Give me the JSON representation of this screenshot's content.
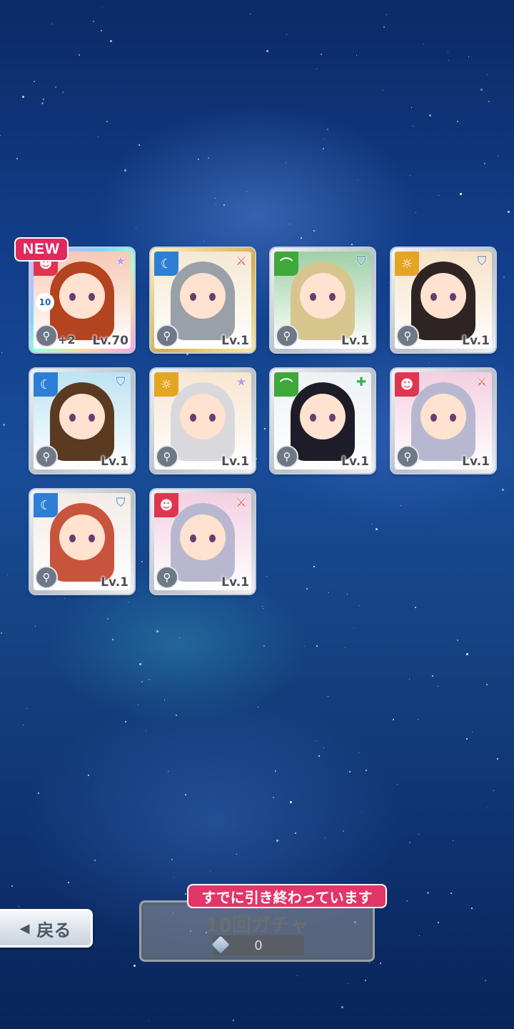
{
  "new_label": "NEW",
  "cards": [
    {
      "attr": "☻",
      "attr_color": "#e0354f",
      "role": "★",
      "role_color": "#b9a0e0",
      "level": "Lv.70",
      "plus": "+2",
      "rank": "10",
      "frame": "rainbow",
      "bg": "#f7c9b4",
      "hair": "#b3441f"
    },
    {
      "attr": "☾",
      "attr_color": "#2d7fd6",
      "role": "⚔",
      "role_color": "#e25b5b",
      "level": "Lv.1",
      "frame": "gold",
      "bg": "#f5e8d3",
      "hair": "#9aa0a8"
    },
    {
      "attr": "⌒",
      "attr_color": "#3ea83a",
      "role": "⛉",
      "role_color": "#3a79d0",
      "level": "Lv.1",
      "frame": "silver",
      "bg": "#9ed0a6",
      "hair": "#d8c58e"
    },
    {
      "attr": "☼",
      "attr_color": "#e5a524",
      "role": "⛉",
      "role_color": "#3a79d0",
      "level": "Lv.1",
      "frame": "silver",
      "bg": "#f7e2c6",
      "hair": "#2e2424"
    },
    {
      "attr": "☾",
      "attr_color": "#2d7fd6",
      "role": "⛉",
      "role_color": "#3a79d0",
      "level": "Lv.1",
      "frame": "silver",
      "bg": "#bde3f2",
      "hair": "#5b3a22"
    },
    {
      "attr": "☼",
      "attr_color": "#e5a524",
      "role": "★",
      "role_color": "#b9a0e0",
      "level": "Lv.1",
      "frame": "silver",
      "bg": "#f8e6d0",
      "hair": "#d9d9dd"
    },
    {
      "attr": "⌒",
      "attr_color": "#3ea83a",
      "role": "✚",
      "role_color": "#3fae53",
      "level": "Lv.1",
      "frame": "silver",
      "bg": "#eef2f5",
      "hair": "#1f1c2a"
    },
    {
      "attr": "☻",
      "attr_color": "#e0354f",
      "role": "⚔",
      "role_color": "#e25b5b",
      "level": "Lv.1",
      "frame": "silver",
      "bg": "#f4cfe2",
      "hair": "#b7b8cf"
    },
    {
      "attr": "☾",
      "attr_color": "#2d7fd6",
      "role": "⛉",
      "role_color": "#3a79d0",
      "level": "Lv.1",
      "frame": "silver",
      "bg": "#f4ebe6",
      "hair": "#c9543e"
    },
    {
      "attr": "☻",
      "attr_color": "#e0354f",
      "role": "⚔",
      "role_color": "#e25b5b",
      "level": "Lv.1",
      "frame": "silver",
      "bg": "#f4cfe2",
      "hair": "#b7b8cf"
    }
  ],
  "done_banner": "すでに引き終わっています",
  "gacha": {
    "title": "10回ガチャ",
    "cost": "0"
  },
  "back_label": "戻る"
}
